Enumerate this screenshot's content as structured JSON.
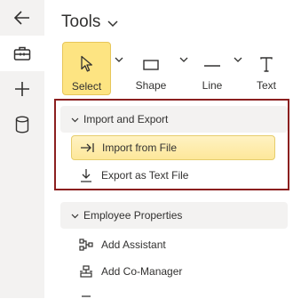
{
  "rail": {
    "items": [
      {
        "icon": "back-arrow-icon"
      },
      {
        "icon": "toolbox-icon"
      },
      {
        "icon": "plus-icon"
      },
      {
        "icon": "database-icon"
      }
    ]
  },
  "panel": {
    "title": "Tools",
    "tools": [
      {
        "label": "Select",
        "icon": "cursor-icon",
        "selected": true
      },
      {
        "label": "Shape",
        "icon": "rectangle-icon"
      },
      {
        "label": "Line",
        "icon": "line-icon"
      },
      {
        "label": "Text",
        "icon": "text-icon"
      }
    ],
    "sections": [
      {
        "title": "Import and Export",
        "items": [
          {
            "label": "Import from File",
            "icon": "import-icon",
            "active": true
          },
          {
            "label": "Export as Text File",
            "icon": "download-icon"
          }
        ]
      },
      {
        "title": "Employee Properties",
        "items": [
          {
            "label": "Add Assistant",
            "icon": "assistant-icon"
          },
          {
            "label": "Add Co-Manager",
            "icon": "co-manager-icon"
          }
        ]
      }
    ]
  },
  "colors": {
    "selected_tool_bg": "#fde482",
    "highlight_border": "#8b1f1f",
    "rail_bg": "#f3f2f1"
  }
}
